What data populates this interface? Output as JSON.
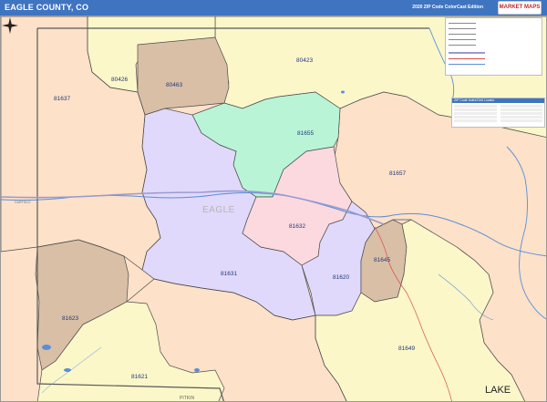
{
  "header": {
    "title": "EAGLE COUNTY, CO",
    "edition": "2020 ZIP Code ColorCast Edition",
    "logo_text": "MARKET MAPS"
  },
  "map": {
    "place_label": "EAGLE",
    "lake_label": "LAKE",
    "pitkin_label": "PITKIN",
    "garfield_label": "GARFIELD",
    "zip_codes": [
      "80423",
      "80426",
      "80463",
      "81637",
      "81655",
      "81657",
      "81632",
      "81631",
      "81620",
      "81645",
      "81623",
      "81649",
      "81621"
    ],
    "colors": {
      "peach": "#fde1c8",
      "yellow": "#fbf7c9",
      "tan": "#d9bfa6",
      "green": "#b9f4d6",
      "pink": "#fbd9df",
      "lavender": "#e0d9fb",
      "water": "#5a8fd8",
      "highway": "#9a9ad0",
      "road": "#d84a4a",
      "border": "#4c4c4c",
      "title_bar": "#3f74c0"
    }
  },
  "legend": {
    "heading": "ZIP Code Index/Grid Locator"
  }
}
